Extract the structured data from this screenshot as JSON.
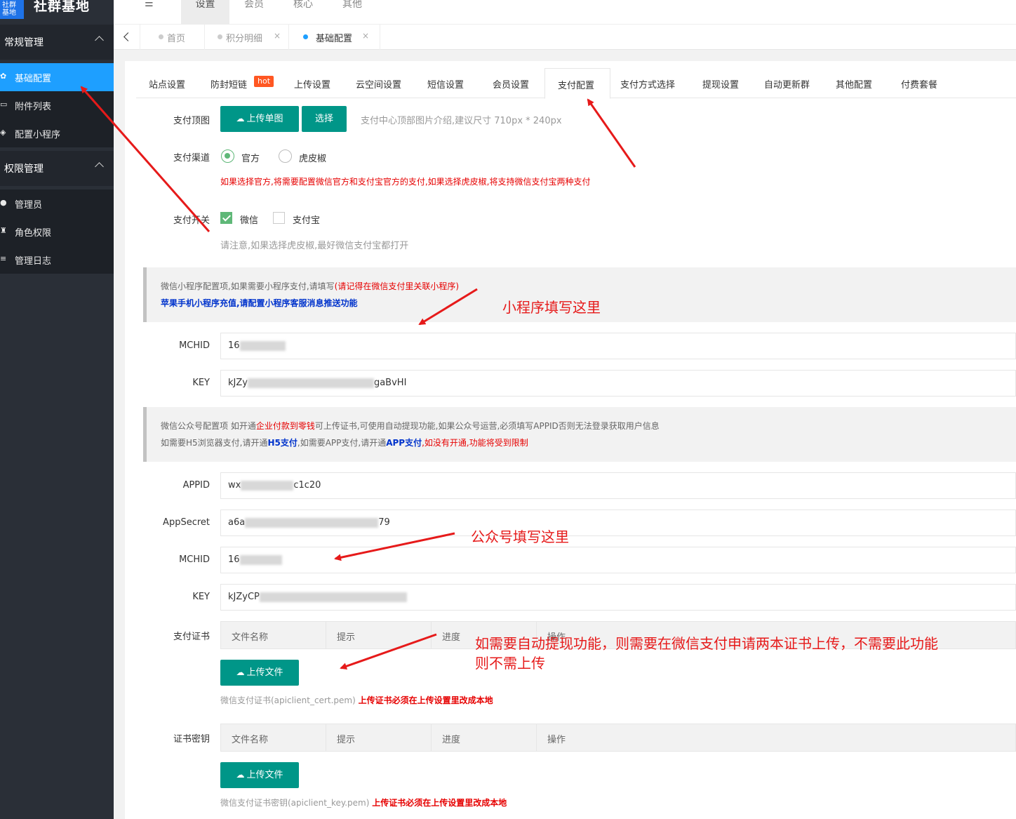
{
  "app": {
    "logo_small": "社群基地",
    "logo_text": "社群基地"
  },
  "sidebar": {
    "groups": [
      {
        "label": "常规管理",
        "items": [
          {
            "label": "基础配置",
            "icon": "gear-icon"
          },
          {
            "label": "附件列表",
            "icon": "folder-icon"
          },
          {
            "label": "配置小程序",
            "icon": "cube-icon"
          }
        ]
      },
      {
        "label": "权限管理",
        "items": [
          {
            "label": "管理员",
            "icon": "user-icon"
          },
          {
            "label": "角色权限",
            "icon": "group-icon"
          },
          {
            "label": "管理日志",
            "icon": "list-icon"
          }
        ]
      }
    ]
  },
  "topnav": {
    "tabs": [
      "设置",
      "会员",
      "核心",
      "其他"
    ]
  },
  "pagetabs": [
    {
      "label": "首页"
    },
    {
      "label": "积分明细"
    },
    {
      "label": "基础配置"
    }
  ],
  "formtabs": [
    "站点设置",
    "防封短链",
    "上传设置",
    "云空间设置",
    "短信设置",
    "会员设置",
    "支付配置",
    "支付方式选择",
    "提现设置",
    "自动更新群",
    "其他配置",
    "付费套餐"
  ],
  "hot_badge": "hot",
  "form": {
    "pay_banner": {
      "label": "支付顶图",
      "upload_btn": "上传单图",
      "select_btn": "选择",
      "hint": "支付中心顶部图片介绍,建议尺寸 710px * 240px"
    },
    "pay_channel": {
      "label": "支付渠道",
      "options": [
        "官方",
        "虎皮椒"
      ],
      "selected": "官方",
      "note": "如果选择官方,将需要配置微信官方和支付宝官方的支付,如果选择虎皮椒,将支持微信支付宝两种支付"
    },
    "pay_switch": {
      "label": "支付开关",
      "options": [
        {
          "label": "微信",
          "checked": true
        },
        {
          "label": "支付宝",
          "checked": false
        }
      ],
      "note": "请注意,如果选择虎皮椒,最好微信支付宝都打开"
    },
    "mini_notice": {
      "line1_a": "微信小程序配置项,如果需要小程序支付,请填写",
      "line1_b": "(请记得在微信支付里关联小程序)",
      "line2": "苹果手机小程序充值,请配置小程序客服消息推送功能"
    },
    "mini_mchid": {
      "label": "MCHID",
      "value_prefix": "16",
      "value_suffix": ""
    },
    "mini_key": {
      "label": "KEY",
      "value_prefix": "kJZy",
      "value_suffix": "gaBvHI"
    },
    "mp_notice": {
      "l1_a": "微信公众号配置项 如开通",
      "l1_b": "企业付款到零钱",
      "l1_c": "可上传证书,可使用自动提现功能,如果公众号运营,必须填写APPID否则无法登录获取用户信息",
      "l2_a": "如需要H5浏览器支付,请开通",
      "l2_b": "H5支付",
      "l2_c": ",如需要APP支付,请开通",
      "l2_d": "APP支付",
      "l2_e": ",如没有开通,功能将受到限制"
    },
    "appid": {
      "label": "APPID",
      "value_prefix": "wx",
      "value_suffix": "c1c20"
    },
    "appsecret": {
      "label": "AppSecret",
      "value_prefix": "a6a",
      "value_suffix": "79"
    },
    "mp_mchid": {
      "label": "MCHID",
      "value_prefix": "16"
    },
    "mp_key": {
      "label": "KEY",
      "value_prefix": "kJZyCP"
    },
    "cert": {
      "label": "支付证书",
      "columns": [
        "文件名称",
        "提示",
        "进度",
        "操作"
      ],
      "upload_btn": "上传文件",
      "hint_a": "微信支付证书(apiclient_cert.pem)",
      "hint_b": "上传证书必须在上传设置里改成本地"
    },
    "cert_key": {
      "label": "证书密钥",
      "columns": [
        "文件名称",
        "提示",
        "进度",
        "操作"
      ],
      "upload_btn": "上传文件",
      "hint_a": "微信支付证书密钥(apiclient_key.pem)",
      "hint_b": "上传证书必须在上传设置里改成本地"
    }
  },
  "annotations": {
    "mini": "小程序填写这里",
    "mp": "公众号填写这里",
    "cert_line1": "如需要自动提现功能，则需要在微信支付申请两本证书上传，不需要此功能",
    "cert_line2": "则不需上传"
  },
  "colors": {
    "accent": "#009688",
    "sidebar_active": "#1e9fff",
    "sidebar_bg": "#2a2f37",
    "annotation": "#e61a1a"
  }
}
